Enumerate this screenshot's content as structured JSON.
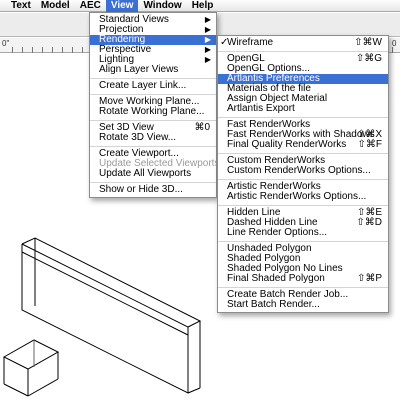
{
  "menubar": {
    "items": [
      "Text",
      "Model",
      "AEC",
      "View",
      "Window",
      "Help"
    ]
  },
  "ruler": {
    "label": "0\"",
    "right_label": "0"
  },
  "view_menu": {
    "groups": [
      [
        {
          "label": "Standard Views",
          "submenu": true
        },
        {
          "label": "Projection",
          "submenu": true
        },
        {
          "label": "Rendering",
          "submenu": true,
          "highlighted": true
        },
        {
          "label": "Perspective",
          "submenu": true
        },
        {
          "label": "Lighting",
          "submenu": true
        },
        {
          "label": "Align Layer Views"
        }
      ],
      [
        {
          "label": "Create Layer Link..."
        }
      ],
      [
        {
          "label": "Move Working Plane..."
        },
        {
          "label": "Rotate Working Plane..."
        }
      ],
      [
        {
          "label": "Set 3D View",
          "shortcut": "⌘0"
        },
        {
          "label": "Rotate 3D View..."
        }
      ],
      [
        {
          "label": "Create Viewport..."
        },
        {
          "label": "Update Selected Viewports",
          "disabled": true
        },
        {
          "label": "Update All Viewports"
        }
      ],
      [
        {
          "label": "Show or Hide 3D..."
        }
      ]
    ]
  },
  "rendering_menu": {
    "groups": [
      [
        {
          "label": "Wireframe",
          "checked": true,
          "shortcut": "⇧⌘W"
        }
      ],
      [
        {
          "label": "OpenGL",
          "shortcut": "⇧⌘G"
        },
        {
          "label": "OpenGL Options..."
        },
        {
          "label": "Artlantis Preferences",
          "highlighted": true
        },
        {
          "label": "Materials of the file"
        },
        {
          "label": "Assign Object Material"
        },
        {
          "label": "Artlantis Export"
        }
      ],
      [
        {
          "label": "Fast RenderWorks"
        },
        {
          "label": "Fast RenderWorks with Shadows",
          "shortcut": "⇧⌘X"
        },
        {
          "label": "Final Quality RenderWorks",
          "shortcut": "⇧⌘F"
        }
      ],
      [
        {
          "label": "Custom RenderWorks"
        },
        {
          "label": "Custom RenderWorks Options..."
        }
      ],
      [
        {
          "label": "Artistic RenderWorks"
        },
        {
          "label": "Artistic RenderWorks Options..."
        }
      ],
      [
        {
          "label": "Hidden Line",
          "shortcut": "⇧⌘E"
        },
        {
          "label": "Dashed Hidden Line",
          "shortcut": "⇧⌘D"
        },
        {
          "label": "Line Render Options..."
        }
      ],
      [
        {
          "label": "Unshaded Polygon"
        },
        {
          "label": "Shaded Polygon"
        },
        {
          "label": "Shaded Polygon No Lines"
        },
        {
          "label": "Final Shaded Polygon",
          "shortcut": "⇧⌘P"
        }
      ],
      [
        {
          "label": "Create Batch Render Job..."
        },
        {
          "label": "Start Batch Render..."
        }
      ]
    ]
  }
}
